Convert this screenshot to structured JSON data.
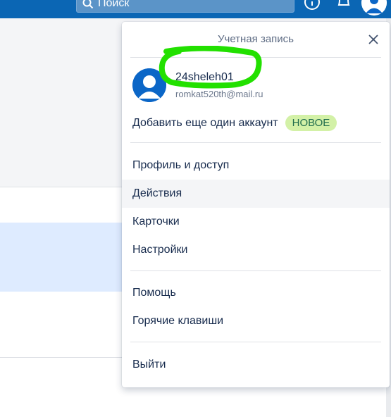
{
  "topbar": {
    "search_placeholder": "Поиск",
    "search_icon": "search-icon",
    "info_icon": "info-icon",
    "bell_icon": "bell-icon",
    "avatar_icon": "user-avatar-icon"
  },
  "account_panel": {
    "title": "Учетная запись",
    "close_icon": "close-icon",
    "user": {
      "name": "24sheleh01",
      "email": "romkat520th@mail.ru"
    },
    "add_account": {
      "label": "Добавить еще один аккаунт",
      "badge": "НОВОЕ"
    },
    "menu_group1": [
      {
        "label": "Профиль и доступ"
      },
      {
        "label": "Действия"
      },
      {
        "label": "Карточки"
      },
      {
        "label": "Настройки"
      }
    ],
    "menu_group2": [
      {
        "label": "Помощь"
      },
      {
        "label": "Горячие клавиши"
      }
    ],
    "logout_label": "Выйти"
  },
  "colors": {
    "header_blue": "#0b66b4",
    "avatar_blue": "#0b66c7",
    "badge_bg": "#d3f1a7",
    "badge_text": "#216e4e",
    "highlight_green": "#22e000",
    "active_row": "#f4f5f7",
    "selected_row_bg": "#deebff"
  }
}
